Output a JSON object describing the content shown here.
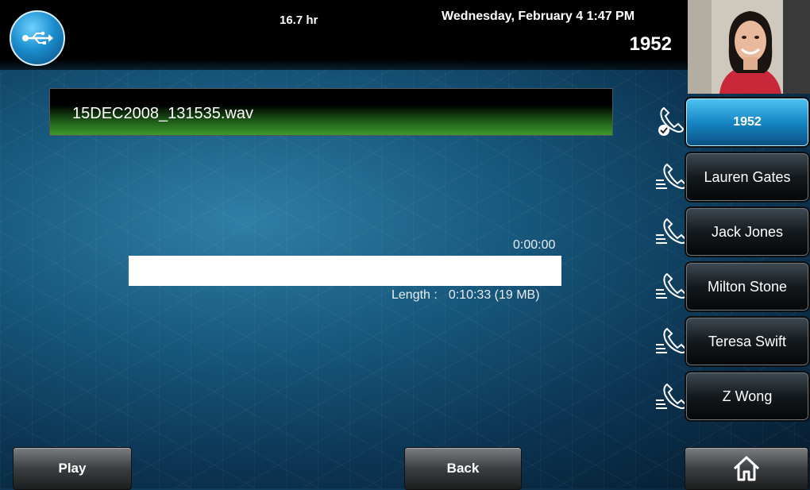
{
  "status_bar": {
    "hours": "16.7 hr",
    "datetime": "Wednesday, February 4  1:47 PM",
    "line": "1952"
  },
  "recording": {
    "filename": "15DEC2008_131535.wav",
    "elapsed": "0:00:00",
    "progress_fraction": 0,
    "length_label": "Length :",
    "length_value": "0:10:33 (19 MB)"
  },
  "line_keys": [
    {
      "label": "1952",
      "active": true
    },
    {
      "label": "Lauren Gates",
      "active": false
    },
    {
      "label": "Jack Jones",
      "active": false
    },
    {
      "label": "Milton Stone",
      "active": false
    },
    {
      "label": "Teresa Swift",
      "active": false
    },
    {
      "label": "Z Wong",
      "active": false
    }
  ],
  "softkeys": {
    "play": "Play",
    "back": "Back"
  },
  "icons": {
    "usb": "usb-icon",
    "line_phone": "phone-handset-icon",
    "home": "home-icon"
  },
  "colors": {
    "accent": "#1c8fd0",
    "file_bar_green": "#3e9a2c"
  }
}
